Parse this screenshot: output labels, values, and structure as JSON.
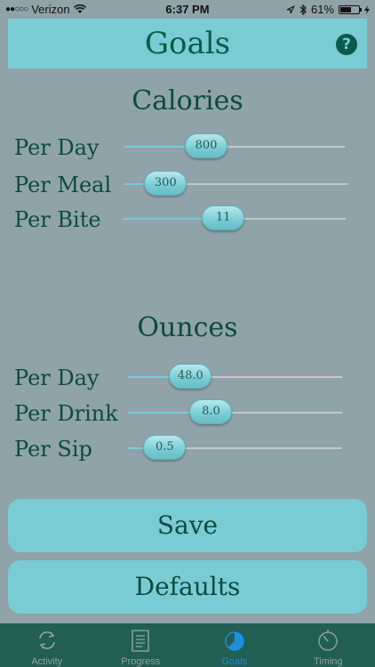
{
  "status_bar": {
    "carrier": "Verizon",
    "time": "6:37 PM",
    "battery": "61%",
    "battery_level": 0.61,
    "signal_dots": "●●○○○"
  },
  "header": {
    "title": "Goals",
    "help_icon": "?"
  },
  "calories": {
    "title": "Calories",
    "rows": [
      {
        "label": "Per Day",
        "value": "800",
        "fraction": 0.34
      },
      {
        "label": "Per Meal",
        "value": "300",
        "fraction": 0.11
      },
      {
        "label": "Per Bite",
        "value": "11",
        "fraction": 0.44
      }
    ]
  },
  "ounces": {
    "title": "Ounces",
    "rows": [
      {
        "label": "Per Day",
        "value": "48.0",
        "fraction": 0.24
      },
      {
        "label": "Per Drink",
        "value": "8.0",
        "fraction": 0.36
      },
      {
        "label": "Per Sip",
        "value": "0.5",
        "fraction": 0.09
      }
    ]
  },
  "buttons": {
    "save": "Save",
    "defaults": "Defaults"
  },
  "tabs": [
    {
      "label": "Activity",
      "icon": "refresh-icon",
      "active": false
    },
    {
      "label": "Progress",
      "icon": "document-icon",
      "active": false
    },
    {
      "label": "Goals",
      "icon": "pie-chart-icon",
      "active": true
    },
    {
      "label": "Timing",
      "icon": "stopwatch-icon",
      "active": false
    }
  ],
  "colors": {
    "accent": "#79ccd4",
    "text": "#0d4a42",
    "background": "#8fa3a8",
    "tab_bar": "#215f52",
    "tab_active": "#1d8fe0"
  }
}
